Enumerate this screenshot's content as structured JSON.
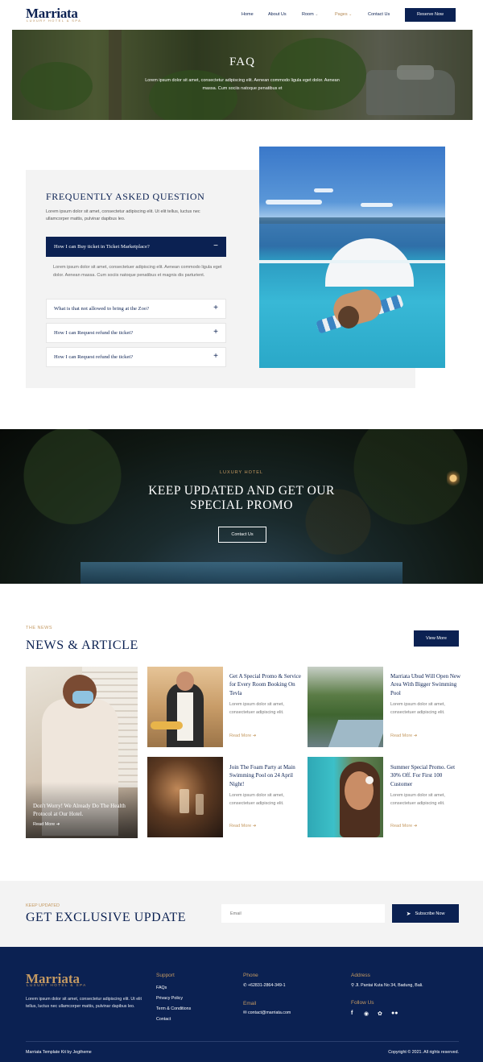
{
  "header": {
    "logo": "Marriata",
    "logo_sub": "LUXURY HOTEL & SPA",
    "nav": [
      {
        "label": "Home"
      },
      {
        "label": "About Us"
      },
      {
        "label": "Room",
        "has_dropdown": true
      },
      {
        "label": "Pages",
        "has_dropdown": true,
        "active": true
      },
      {
        "label": "Contact Us"
      }
    ],
    "reserve_label": "Reserve Now"
  },
  "hero": {
    "title": "FAQ",
    "text": "Lorem ipsum dolor sit amet, consectetur adipiscing elit. Aenean commodo ligula eget dolor. Aenean massa. Cum sociis natoque penatibus et"
  },
  "faq": {
    "title": "FREQUENTLY ASKED QUESTION",
    "intro": "Lorem ipsum dolor sit amet, consectetur adipiscing elit. Ut elit tellus, luctus nec ullamcorper mattis, pulvinar dapibus leo.",
    "items": [
      {
        "q": "How I can Buy ticket in Ticket Marketplace?",
        "open": true,
        "sign": "−"
      },
      {
        "q": "What is that not allowed to bring at the Zoo?",
        "open": false,
        "sign": "+"
      },
      {
        "q": "How I can Request refund the ticket?",
        "open": false,
        "sign": "+"
      },
      {
        "q": "How I can Request refund the ticket?",
        "open": false,
        "sign": "+"
      }
    ],
    "answer": "Lorem ipsum dolor sit amet, consectetuer adipiscing elit. Aenean commodo ligula eget dolor. Aenean massa. Cum sociis natoque penatibus et magnis dis parturient."
  },
  "promo": {
    "kicker": "LUXURY HOTEL",
    "title": "KEEP UPDATED AND GET OUR SPECIAL PROMO",
    "button": "Contact Us"
  },
  "news": {
    "kicker": "THE NEWS",
    "title": "NEWS & ARTICLE",
    "view_more": "View More",
    "featured": {
      "title": "Don't Worry! We Already Do The Health Protocol at Our Hotel.",
      "read": "Read More"
    },
    "cards": [
      {
        "title": "Get A Special Promo & Service for Every Room Booking On Tevla",
        "text": "Lorem ipsum dolor sit amet, consectetuer adipiscing elit.",
        "read": "Read More"
      },
      {
        "title": "Marriata Ubud Will Open New Area With Bigger Swimming Pool",
        "text": "Lorem ipsum dolor sit amet, consectetuer adipiscing elit.",
        "read": "Read More"
      },
      {
        "title": "Join The Foam Party at Main Swimming Pool on 24 April Night!",
        "text": "Lorem ipsum dolor sit amet, consectetuer adipiscing elit.",
        "read": "Read More"
      },
      {
        "title": "Summer Special Promo. Get 30% Off. For First 100 Customer",
        "text": "Lorem ipsum dolor sit amet, consectetuer adipiscing elit.",
        "read": "Read More"
      }
    ]
  },
  "subscribe": {
    "kicker": "KEEP UPDATED",
    "title": "GET EXCLUSIVE UPDATE",
    "placeholder": "Email",
    "button": "Subscribe Now"
  },
  "footer": {
    "logo": "Marriata",
    "logo_sub": "LUXURY HOTEL & SPA",
    "about": "Lorem ipsum dolor sit amet, consectetur adipiscing elit. Ut elit tellus, luctus nec ullamcorper mattis, pulvinar dapibus leo.",
    "support_head": "Support",
    "support_links": [
      "FAQs",
      "Privacy Policy",
      "Term & Conditions",
      "Contact"
    ],
    "phone_head": "Phone",
    "phone": "+62831-2864-349-1",
    "email_head": "Email",
    "email": "contact@marriata.com",
    "address_head": "Address",
    "address": "Jl. Pantai Kuta No 34, Badung, Bali.",
    "follow_head": "Follow Us",
    "credit": "Marriata Template Kit by Jegtheme",
    "copyright": "Copyright © 2021. All rights reserved."
  }
}
